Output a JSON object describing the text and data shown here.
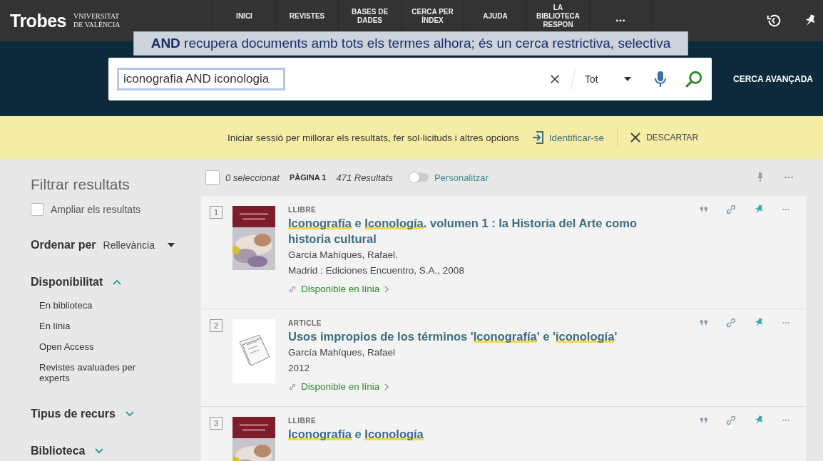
{
  "header": {
    "logo": "Trobes",
    "university": [
      "VNIVERSITAT",
      "DE VALÈNCIA"
    ],
    "nav": [
      {
        "label": "INICI"
      },
      {
        "label": "REVISTES"
      },
      {
        "label": "BASES DE DADES"
      },
      {
        "label": "CERCA PER ÍNDEX"
      },
      {
        "label": "AJUDA"
      },
      {
        "label": "LA BIBLIOTECA RESPON"
      }
    ]
  },
  "tooltip": "**AND** recupera documents amb tots els termes alhora; és un cerca restrictiva, selectiva",
  "search": {
    "value": "iconografia AND iconologia",
    "scope": "Tot",
    "advanced": "CERCA AVANÇADA"
  },
  "banner": {
    "message": "Iniciar sessió per millorar els resultats, fer sol·licituds i altres opcions",
    "login": "Identificar-se",
    "dismiss": "DESCARTAR"
  },
  "sidebar": {
    "title": "Filtrar resultats",
    "expand": {
      "label": "Ampliar els resultats",
      "checked": false
    },
    "sort": {
      "label": "Ordenar per",
      "value": "Rellevància"
    },
    "facets": [
      {
        "label": "Disponibilitat",
        "expanded": true,
        "items": [
          "En biblioteca",
          "En línia",
          "Open Access",
          "Revistes avaluades per experts"
        ]
      },
      {
        "label": "Tipus de recurs",
        "expanded": false
      },
      {
        "label": "Biblioteca",
        "expanded": false
      }
    ]
  },
  "toolbar": {
    "select_all": {
      "checked": false
    },
    "selected": "0 seleccionat",
    "page": "PÀGINA 1",
    "count": "471 Resultats",
    "personalize": {
      "label": "Personalitzar",
      "on": false
    }
  },
  "results": [
    {
      "number": "1",
      "type": "LLIBRE",
      "kind": "cover",
      "title": [
        {
          "text": "Iconografía",
          "highlight": true
        },
        {
          "text": " e ",
          "highlight": false
        },
        {
          "text": "Iconología",
          "highlight": true
        },
        {
          "text": ". volumen 1 : la Historia del Arte como historia cultural",
          "highlight": false
        }
      ],
      "lines": [
        "García Mahíques, Rafael.",
        "Madrid : Ediciones Encuentro, S.A., 2008"
      ],
      "availability": "Disponible en línia"
    },
    {
      "number": "2",
      "type": "ARTICLE",
      "kind": "article",
      "title": [
        {
          "text": "Usos impropios de los términos '",
          "highlight": false
        },
        {
          "text": "Iconografía",
          "highlight": true
        },
        {
          "text": "' e '",
          "highlight": false
        },
        {
          "text": "iconología",
          "highlight": true
        },
        {
          "text": "'",
          "highlight": false
        }
      ],
      "lines": [
        "García Mahíques, Rafael",
        "2012"
      ],
      "availability": "Disponible en línia"
    },
    {
      "number": "3",
      "type": "LLIBRE",
      "kind": "cover",
      "title": [
        {
          "text": "Iconografía",
          "highlight": true
        },
        {
          "text": " e ",
          "highlight": false
        },
        {
          "text": "Iconología",
          "highlight": true
        }
      ]
    }
  ]
}
